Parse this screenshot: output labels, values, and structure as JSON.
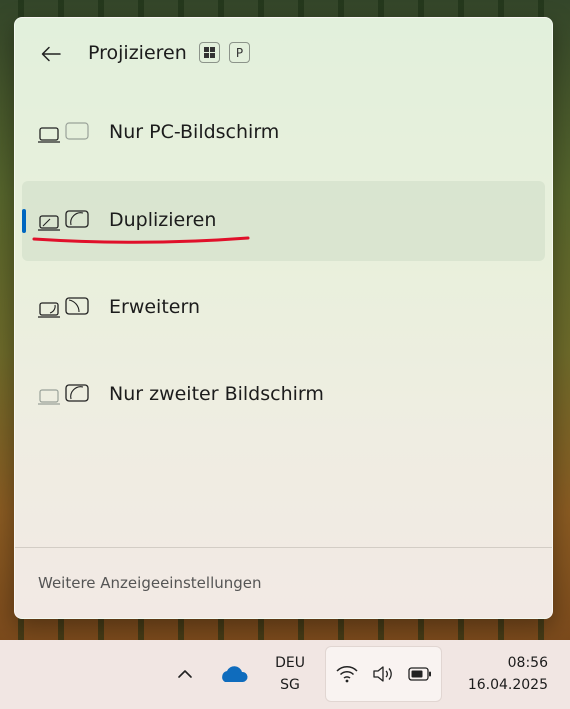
{
  "panel": {
    "title": "Projizieren",
    "shortcut_keys": [
      "win-key-icon",
      "P"
    ],
    "options": [
      {
        "label": "Nur PC-Bildschirm",
        "icon": "pc-screen-only-icon",
        "selected": false
      },
      {
        "label": "Duplizieren",
        "icon": "duplicate-icon",
        "selected": true
      },
      {
        "label": "Erweitern",
        "icon": "extend-icon",
        "selected": false
      },
      {
        "label": "Nur zweiter Bildschirm",
        "icon": "second-screen-only-icon",
        "selected": false
      }
    ],
    "footer_link": "Weitere Anzeigeeinstellungen"
  },
  "taskbar": {
    "language_line1": "DEU",
    "language_line2": "SG",
    "time": "08:56",
    "date": "16.04.2025"
  },
  "colors": {
    "accent": "#0067c0",
    "annotation_red": "#e0102a"
  }
}
